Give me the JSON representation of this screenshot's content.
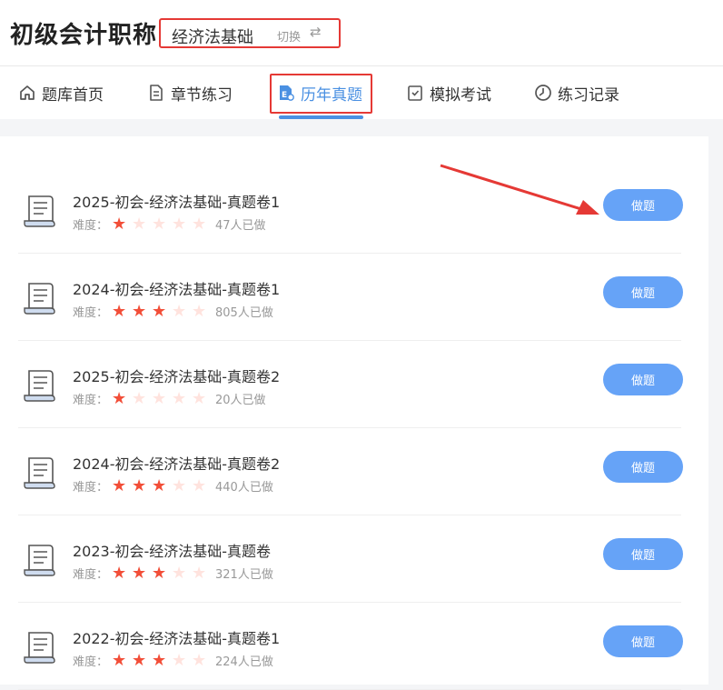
{
  "header": {
    "title": "初级会计职称",
    "subject": "经济法基础",
    "switch_label": "切换"
  },
  "tabs": [
    {
      "label": "题库首页",
      "icon": "home-icon"
    },
    {
      "label": "章节练习",
      "icon": "document-icon"
    },
    {
      "label": "历年真题",
      "icon": "past-exam-icon",
      "active": true
    },
    {
      "label": "模拟考试",
      "icon": "checklist-icon"
    },
    {
      "label": "练习记录",
      "icon": "clock-icon"
    }
  ],
  "difficulty_label": "难度：",
  "do_label": "做题",
  "papers": [
    {
      "title": "2025-初会-经济法基础-真题卷1",
      "stars": 1,
      "count": "47人已做"
    },
    {
      "title": "2024-初会-经济法基础-真题卷1",
      "stars": 3,
      "count": "805人已做"
    },
    {
      "title": "2025-初会-经济法基础-真题卷2",
      "stars": 1,
      "count": "20人已做"
    },
    {
      "title": "2024-初会-经济法基础-真题卷2",
      "stars": 3,
      "count": "440人已做"
    },
    {
      "title": "2023-初会-经济法基础-真题卷",
      "stars": 3,
      "count": "321人已做"
    },
    {
      "title": "2022-初会-经济法基础-真题卷1",
      "stars": 3,
      "count": "224人已做"
    }
  ],
  "max_stars": 5,
  "colors": {
    "accent": "#4a90e2",
    "button": "#66a3f7",
    "star_on": "#f24e38",
    "star_off": "#ffe3de",
    "highlight": "#e53935"
  }
}
